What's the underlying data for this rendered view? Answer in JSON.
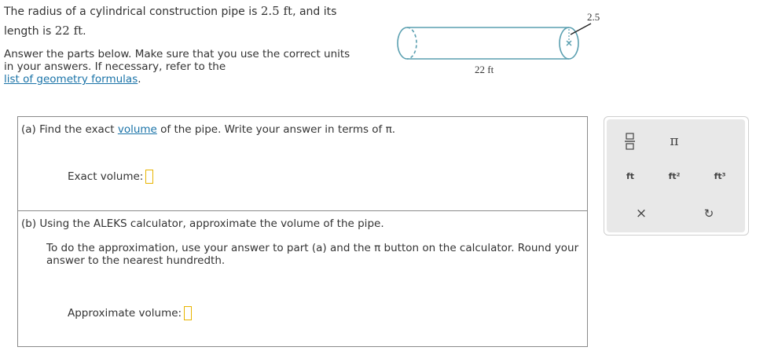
{
  "problem": {
    "p1_text": "The radius of a cylindrical construction pipe is ",
    "radius_value": "2.5 ft",
    "p1_mid": ", and its",
    "p2_text": "length is ",
    "length_value": "22 ft",
    "p2_end": ".",
    "instr_text": "Answer the parts below. Make sure that you use the correct units in your answers. If necessary, refer to the",
    "formulas_link": "list of geometry formulas",
    "formulas_end": "."
  },
  "diagram": {
    "radius_label": "2.5 ft",
    "length_label": "22 ft"
  },
  "part_a": {
    "prefix": "(a)  Find the exact ",
    "volume_link": "volume",
    "suffix": " of the pipe. Write your answer in terms of π.",
    "answer_label": "Exact volume:"
  },
  "part_b": {
    "line1": "(b)  Using the ALEKS calculator, approximate the volume of the pipe.",
    "line2": "To do the approximation, use your answer to part (a) and the π button on the calculator. Round your answer to the nearest hundredth.",
    "answer_label": "Approximate volume:"
  },
  "palette": {
    "pi": "π",
    "ft": "ft",
    "ft2": "ft²",
    "ft3": "ft³",
    "clear": "×",
    "undo": "↻",
    "fraction_icon": "fraction-icon"
  }
}
